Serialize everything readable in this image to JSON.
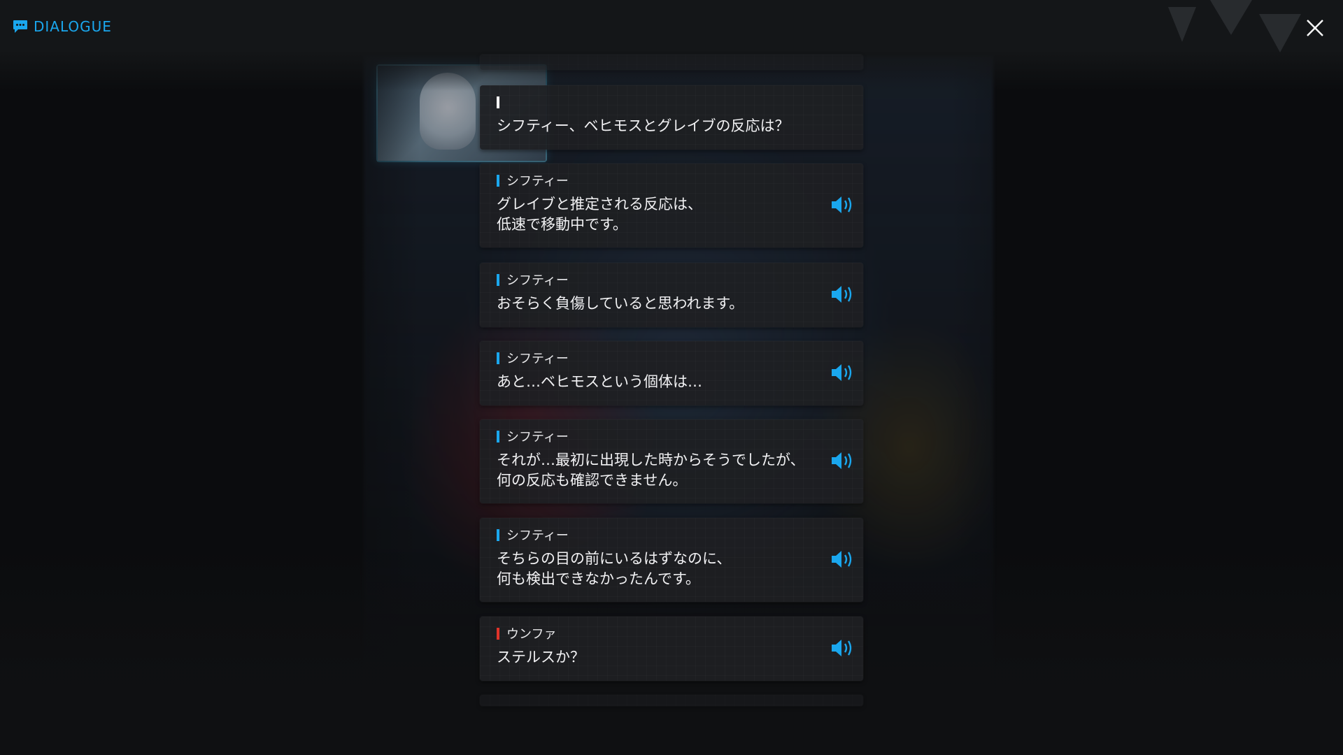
{
  "header": {
    "title": "DIALOGUE",
    "icon": "chat-bubble-icon"
  },
  "colors": {
    "accent": "#1aa7ee",
    "speaker_marker_player": "#ffffff",
    "speaker_marker_npc": "#1aa7ee",
    "speaker_marker_alt": "#e0332a",
    "panel": "#1e1f22",
    "background": "#0b0c0e"
  },
  "dialogue": [
    {
      "speaker": "",
      "marker": "white",
      "text": "シフティー、ベヒモスとグレイブの反応は？",
      "has_voice": false
    },
    {
      "speaker": "シフティー",
      "marker": "blue",
      "text": "グレイブと推定される反応は、\n低速で移動中です。",
      "has_voice": true
    },
    {
      "speaker": "シフティー",
      "marker": "blue",
      "text": "おそらく負傷していると思われます。",
      "has_voice": true
    },
    {
      "speaker": "シフティー",
      "marker": "blue",
      "text": "あと…ベヒモスという個体は…",
      "has_voice": true
    },
    {
      "speaker": "シフティー",
      "marker": "blue",
      "text": "それが…最初に出現した時からそうでしたが、\n何の反応も確認できません。",
      "has_voice": true
    },
    {
      "speaker": "シフティー",
      "marker": "blue",
      "text": "そちらの目の前にいるはずなのに、\n何も検出できなかったんです。",
      "has_voice": true
    },
    {
      "speaker": "ウンファ",
      "marker": "red",
      "text": "ステルスか？",
      "has_voice": true
    }
  ],
  "icons": {
    "voice": "speaker-volume-icon",
    "close": "close-icon"
  }
}
